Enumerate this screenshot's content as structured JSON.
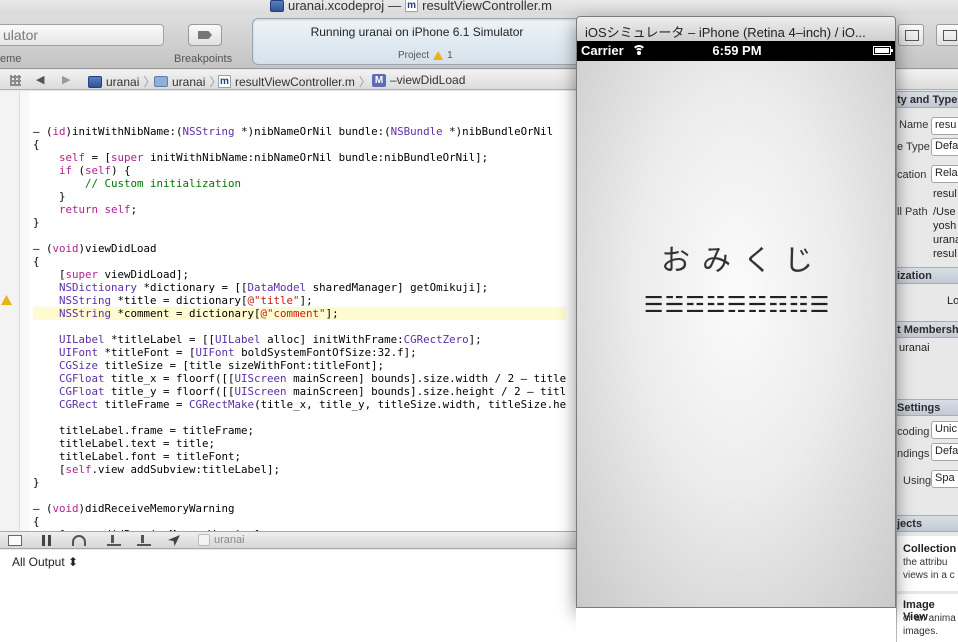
{
  "window": {
    "project_file": "uranai.xcodeproj",
    "separator": "—",
    "current_file": "resultViewController.m"
  },
  "toolbar": {
    "scheme_value": "ulator",
    "scheme_caption": "eme",
    "breakpoints_label": "Breakpoints",
    "activity_status": "Running uranai on iPhone 6.1 Simulator",
    "activity_project_label": "Project",
    "warning_count": "1"
  },
  "jumpbar": {
    "crumbs": [
      "uranai",
      "uranai",
      "resultViewController.m",
      "–viewDidLoad"
    ]
  },
  "editor": {
    "lines": [
      "",
      "– (id)initWithNibName:(NSString *)nibNameOrNil bundle:(NSBundle *)nibBundleOrNil",
      "{",
      "    self = [super initWithNibName:nibNameOrNil bundle:nibBundleOrNil];",
      "    if (self) {",
      "        // Custom initialization",
      "    }",
      "    return self;",
      "}",
      "",
      "– (void)viewDidLoad",
      "{",
      "    [super viewDidLoad];",
      "    NSDictionary *dictionary = [[DataModel sharedManager] getOmikuji];",
      "    NSString *title = dictionary[@\"title\"];",
      "    NSString *comment = dictionary[@\"comment\"];",
      "",
      "    UILabel *titleLabel = [[UILabel alloc] initWithFrame:CGRectZero];",
      "    UIFont *titleFont = [UIFont boldSystemFontOfSize:32.f];",
      "    CGSize titleSize = [title sizeWithFont:titleFont];",
      "    CGFloat title_x = floorf([[UIScreen mainScreen] bounds].size.width / 2 – title",
      "    CGFloat title_y = floorf([[UIScreen mainScreen] bounds].size.height / 2 – titl",
      "    CGRect titleFrame = CGRectMake(title_x, title_y, titleSize.width, titleSize.he",
      "",
      "    titleLabel.frame = titleFrame;",
      "    titleLabel.text = title;",
      "    titleLabel.font = titleFont;",
      "    [self.view addSubview:titleLabel];",
      "}",
      "",
      "– (void)didReceiveMemoryWarning",
      "{",
      "    [super didReceiveMemoryWarning];"
    ],
    "highlighted_line": 15
  },
  "debugbar": {
    "target": "uranai"
  },
  "console": {
    "output_selector": "All Output ⬍"
  },
  "utilities": {
    "section_identity": "ty and Type",
    "name_label": "Name",
    "name_value": "resu",
    "filetype_label": "e Type",
    "filetype_value": "Defa",
    "location_label": "cation",
    "location_value": "Rela",
    "location_text_1": "resul",
    "fullpath_label": "ll Path",
    "fullpath_lines": [
      "/Use",
      "yosh",
      "urana",
      "resul"
    ],
    "section_localization": "ization",
    "localization_value": "Lo",
    "section_target": "t Membersh",
    "target_item": "uranai",
    "section_text_settings": "Settings",
    "encoding_label": "coding",
    "encoding_value": "Unic",
    "endings_label": "ndings",
    "endings_value": "Defa",
    "indent_label": "Using",
    "indent_value": "Spa",
    "section_objects": "jects",
    "lib_items": [
      {
        "title": "Collection",
        "desc_1": "the attribu",
        "desc_2": "views in a c"
      },
      {
        "title": "Image View",
        "desc_1": "or an anima",
        "desc_2": "images."
      }
    ]
  },
  "simulator": {
    "window_title": "iOSシミュレータ – iPhone (Retina 4–inch) / iO...",
    "carrier": "Carrier",
    "time": "6:59 PM",
    "omikuji_title": "おみくじ",
    "omikuji_comment": "☰☱☲☳☴☵☶☷☰"
  }
}
